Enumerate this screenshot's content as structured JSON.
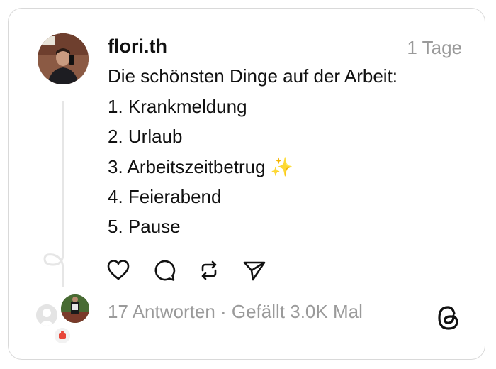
{
  "post": {
    "username": "flori.th",
    "timestamp": "1 Tage",
    "lines": [
      "Die schönsten Dinge auf der Arbeit:",
      "1. Krankmeldung",
      "2. Urlaub",
      "3. Arbeitszeitbetrug ✨",
      "4. Feierabend",
      "5. Pause"
    ]
  },
  "actions": {
    "icons": [
      "heart-icon",
      "comment-icon",
      "repost-icon",
      "share-icon"
    ]
  },
  "stats": {
    "text": "17 Antworten · Gefällt 3.0K Mal"
  },
  "colors": {
    "text": "#111111",
    "muted": "#9a9a9a",
    "border": "#d9d9d9",
    "thread_line": "#e6e6e6"
  }
}
